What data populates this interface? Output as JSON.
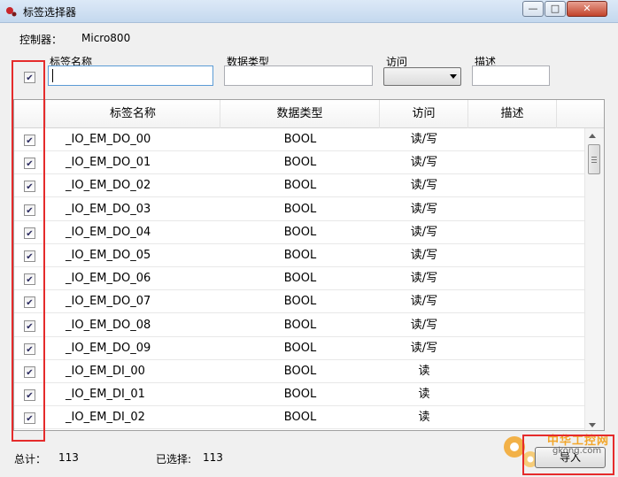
{
  "window": {
    "title": "标签选择器",
    "buttons": {
      "minimize": "—",
      "maximize": "□",
      "close": "✕"
    }
  },
  "controller": {
    "label": "控制器：",
    "value": "Micro800"
  },
  "filter": {
    "select_all_checked": true,
    "name_label": "标签名称",
    "type_label": "数据类型",
    "access_label": "访问",
    "desc_label": "描述",
    "name_value": "",
    "type_value": "",
    "access_value": "",
    "desc_value": ""
  },
  "grid": {
    "columns": [
      "标签名称",
      "数据类型",
      "访问",
      "描述"
    ],
    "rows": [
      {
        "checked": true,
        "name": "_IO_EM_DO_00",
        "type": "BOOL",
        "access": "读/写",
        "desc": ""
      },
      {
        "checked": true,
        "name": "_IO_EM_DO_01",
        "type": "BOOL",
        "access": "读/写",
        "desc": ""
      },
      {
        "checked": true,
        "name": "_IO_EM_DO_02",
        "type": "BOOL",
        "access": "读/写",
        "desc": ""
      },
      {
        "checked": true,
        "name": "_IO_EM_DO_03",
        "type": "BOOL",
        "access": "读/写",
        "desc": ""
      },
      {
        "checked": true,
        "name": "_IO_EM_DO_04",
        "type": "BOOL",
        "access": "读/写",
        "desc": ""
      },
      {
        "checked": true,
        "name": "_IO_EM_DO_05",
        "type": "BOOL",
        "access": "读/写",
        "desc": ""
      },
      {
        "checked": true,
        "name": "_IO_EM_DO_06",
        "type": "BOOL",
        "access": "读/写",
        "desc": ""
      },
      {
        "checked": true,
        "name": "_IO_EM_DO_07",
        "type": "BOOL",
        "access": "读/写",
        "desc": ""
      },
      {
        "checked": true,
        "name": "_IO_EM_DO_08",
        "type": "BOOL",
        "access": "读/写",
        "desc": ""
      },
      {
        "checked": true,
        "name": "_IO_EM_DO_09",
        "type": "BOOL",
        "access": "读/写",
        "desc": ""
      },
      {
        "checked": true,
        "name": "_IO_EM_DI_00",
        "type": "BOOL",
        "access": "读",
        "desc": ""
      },
      {
        "checked": true,
        "name": "_IO_EM_DI_01",
        "type": "BOOL",
        "access": "读",
        "desc": ""
      },
      {
        "checked": true,
        "name": "_IO_EM_DI_02",
        "type": "BOOL",
        "access": "读",
        "desc": ""
      }
    ]
  },
  "footer": {
    "total_label": "总计：",
    "total_value": "113",
    "selected_label": "已选择:",
    "selected_value": "113",
    "import_label": "导入"
  },
  "watermark": {
    "line1": "中华工控网",
    "line2": "gkong.com"
  },
  "colors": {
    "highlight": "#e52b2b",
    "titlebar": "#c4d8ee"
  }
}
